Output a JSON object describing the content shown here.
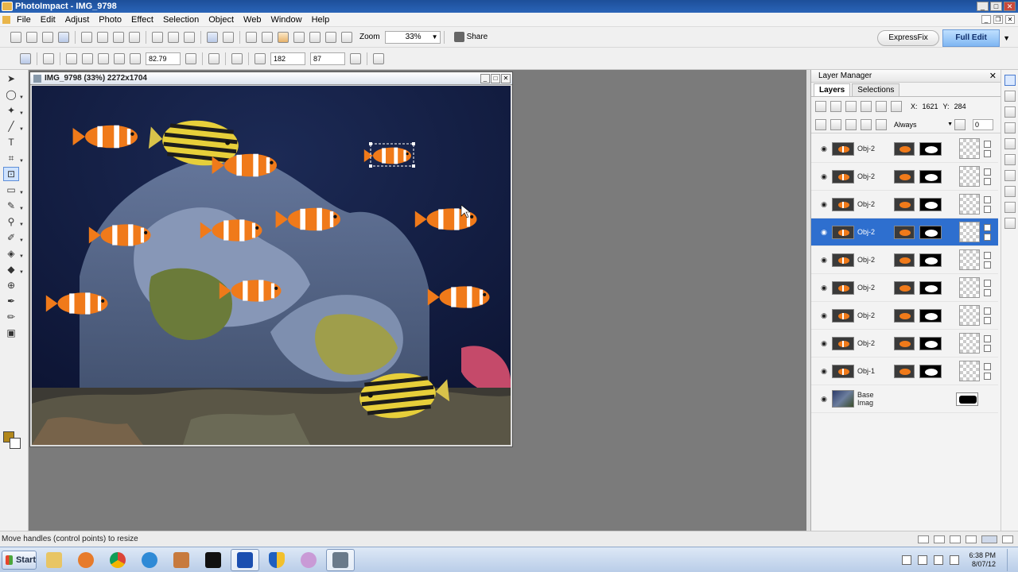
{
  "window": {
    "title": "PhotoImpact - IMG_9798",
    "controls": [
      "minimize",
      "maximize",
      "close"
    ]
  },
  "menu": [
    "File",
    "Edit",
    "Adjust",
    "Photo",
    "Effect",
    "Selection",
    "Object",
    "Web",
    "Window",
    "Help"
  ],
  "toolbar": {
    "zoom_label": "Zoom",
    "zoom_value": "33%",
    "share_label": "Share",
    "expressfix_label": "ExpressFix",
    "fulledit_label": "Full Edit"
  },
  "attribute_bar": {
    "rotate_value": "82.79",
    "width_value": "182",
    "height_value": "87"
  },
  "document": {
    "title": "IMG_9798 (33%) 2272x1704"
  },
  "layer_manager": {
    "title": "Layer Manager",
    "tabs": [
      "Layers",
      "Selections"
    ],
    "x_label": "X:",
    "x_value": "1621",
    "y_label": "Y:",
    "y_value": "284",
    "merge_mode": "Always",
    "opacity": "0",
    "layers": [
      {
        "name": "Obj-2",
        "selected": false
      },
      {
        "name": "Obj-2",
        "selected": false
      },
      {
        "name": "Obj-2",
        "selected": false
      },
      {
        "name": "Obj-2",
        "selected": true
      },
      {
        "name": "Obj-2",
        "selected": false
      },
      {
        "name": "Obj-2",
        "selected": false
      },
      {
        "name": "Obj-2",
        "selected": false
      },
      {
        "name": "Obj-2",
        "selected": false
      },
      {
        "name": "Obj-1",
        "selected": false
      }
    ],
    "base_layer": "Base Imag"
  },
  "status": {
    "text": "Move handles (control points) to resize"
  },
  "taskbar": {
    "start_label": "Start",
    "time": "6:38 PM",
    "date": "8/07/12"
  },
  "colors": {
    "accent": "#2e6fcf",
    "foreground_swatch": "#b2871a",
    "background_swatch": "#ffffff",
    "clownfish": "#f07a1a"
  }
}
